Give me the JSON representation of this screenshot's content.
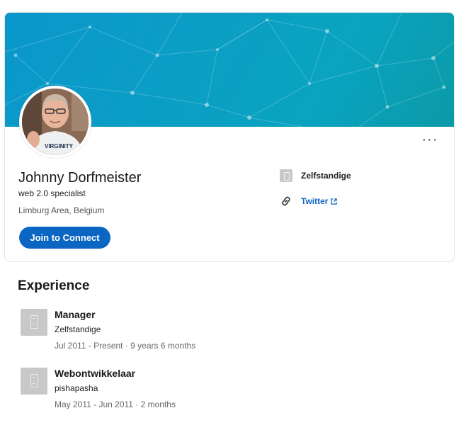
{
  "profile": {
    "name": "Johnny Dorfmeister",
    "headline": "web 2.0 specialist",
    "location": "Limburg Area, Belgium",
    "join_label": "Join to Connect",
    "more_label": "···"
  },
  "sidebar": {
    "company": "Zelfstandige",
    "twitter_label": "Twitter"
  },
  "experience": {
    "title": "Experience",
    "items": [
      {
        "title": "Manager",
        "company": "Zelfstandige",
        "dates": "Jul 2011 - Present · 9 years 6 months"
      },
      {
        "title": "Webontwikkelaar",
        "company": "pishapasha",
        "dates": "May 2011 - Jun 2011 · 2 months"
      }
    ]
  },
  "colors": {
    "brand_blue": "#0a66c2",
    "banner_start": "#0a97cc",
    "banner_end": "#0b9aa8",
    "placeholder_gray": "#c8c8c8"
  }
}
